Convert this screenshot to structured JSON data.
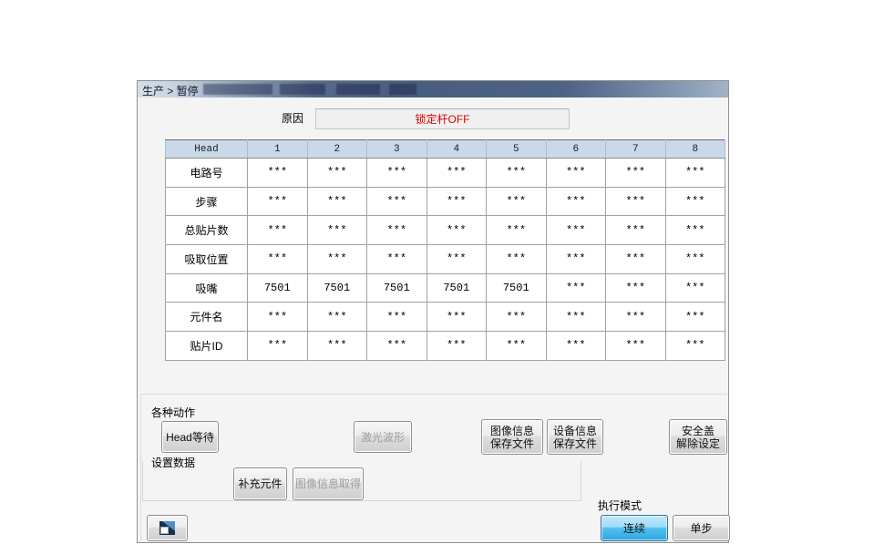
{
  "window": {
    "title": "生产 > 暂停"
  },
  "reason": {
    "label": "原因",
    "value": "锁定杆OFF",
    "value_color": "#e00000"
  },
  "table": {
    "header": [
      "Head",
      "1",
      "2",
      "3",
      "4",
      "5",
      "6",
      "7",
      "8"
    ],
    "header_bg": "#c9d9ea",
    "rows": [
      {
        "label": "电路号",
        "values": [
          "***",
          "***",
          "***",
          "***",
          "***",
          "***",
          "***",
          "***"
        ]
      },
      {
        "label": "步骤",
        "values": [
          "***",
          "***",
          "***",
          "***",
          "***",
          "***",
          "***",
          "***"
        ]
      },
      {
        "label": "总贴片数",
        "values": [
          "***",
          "***",
          "***",
          "***",
          "***",
          "***",
          "***",
          "***"
        ]
      },
      {
        "label": "吸取位置",
        "values": [
          "***",
          "***",
          "***",
          "***",
          "***",
          "***",
          "***",
          "***"
        ]
      },
      {
        "label": "吸嘴",
        "values": [
          "7501",
          "7501",
          "7501",
          "7501",
          "7501",
          "***",
          "***",
          "***"
        ]
      },
      {
        "label": "元件名",
        "values": [
          "***",
          "***",
          "***",
          "***",
          "***",
          "***",
          "***",
          "***"
        ]
      },
      {
        "label": "贴片ID",
        "values": [
          "***",
          "***",
          "***",
          "***",
          "***",
          "***",
          "***",
          "***"
        ]
      }
    ]
  },
  "groups": {
    "actions": "各种动作",
    "settings": "设置数据",
    "exec_mode": "执行模式"
  },
  "buttons": {
    "head_wait": "Head等待",
    "laser_waveform": "激光波形",
    "image_info_save": [
      "图像信息",
      "保存文件"
    ],
    "device_info_save": [
      "设备信息",
      "保存文件"
    ],
    "safety_cover_release": [
      "安全盖",
      "解除设定"
    ],
    "replenish_component": "补充元件",
    "image_info_acquire": "图像信息取得",
    "continuous": "连续",
    "single_step": "单步"
  }
}
